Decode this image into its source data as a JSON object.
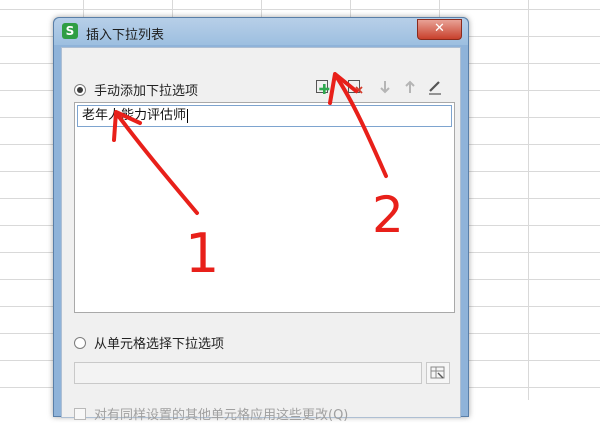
{
  "dialog": {
    "title": "插入下拉列表",
    "app_icon_glyph": "S",
    "close_glyph": "✕"
  },
  "manual_option": {
    "label": "手动添加下拉选项",
    "checked": true
  },
  "toolbar": {
    "icons": [
      "add-item-icon",
      "delete-item-icon",
      "move-down-icon",
      "move-up-icon",
      "edit-icon"
    ],
    "accent_add": "#2fa84f",
    "accent_delete": "#d23b2b"
  },
  "items_list": {
    "items": [
      "老年人能力评估师"
    ]
  },
  "cell_option": {
    "label": "从单元格选择下拉选项",
    "checked": false
  },
  "apply_option": {
    "label": "对有同样设置的其他单元格应用这些更改(Q)"
  },
  "annotations": {
    "color": "#e8201a",
    "label_1": "1",
    "label_2": "2"
  }
}
